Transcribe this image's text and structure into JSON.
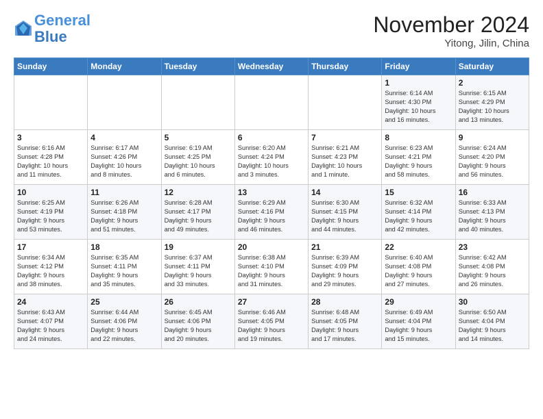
{
  "header": {
    "logo_line1": "General",
    "logo_line2": "Blue",
    "month": "November 2024",
    "location": "Yitong, Jilin, China"
  },
  "weekdays": [
    "Sunday",
    "Monday",
    "Tuesday",
    "Wednesday",
    "Thursday",
    "Friday",
    "Saturday"
  ],
  "weeks": [
    [
      {
        "day": "",
        "info": ""
      },
      {
        "day": "",
        "info": ""
      },
      {
        "day": "",
        "info": ""
      },
      {
        "day": "",
        "info": ""
      },
      {
        "day": "",
        "info": ""
      },
      {
        "day": "1",
        "info": "Sunrise: 6:14 AM\nSunset: 4:30 PM\nDaylight: 10 hours\nand 16 minutes."
      },
      {
        "day": "2",
        "info": "Sunrise: 6:15 AM\nSunset: 4:29 PM\nDaylight: 10 hours\nand 13 minutes."
      }
    ],
    [
      {
        "day": "3",
        "info": "Sunrise: 6:16 AM\nSunset: 4:28 PM\nDaylight: 10 hours\nand 11 minutes."
      },
      {
        "day": "4",
        "info": "Sunrise: 6:17 AM\nSunset: 4:26 PM\nDaylight: 10 hours\nand 8 minutes."
      },
      {
        "day": "5",
        "info": "Sunrise: 6:19 AM\nSunset: 4:25 PM\nDaylight: 10 hours\nand 6 minutes."
      },
      {
        "day": "6",
        "info": "Sunrise: 6:20 AM\nSunset: 4:24 PM\nDaylight: 10 hours\nand 3 minutes."
      },
      {
        "day": "7",
        "info": "Sunrise: 6:21 AM\nSunset: 4:23 PM\nDaylight: 10 hours\nand 1 minute."
      },
      {
        "day": "8",
        "info": "Sunrise: 6:23 AM\nSunset: 4:21 PM\nDaylight: 9 hours\nand 58 minutes."
      },
      {
        "day": "9",
        "info": "Sunrise: 6:24 AM\nSunset: 4:20 PM\nDaylight: 9 hours\nand 56 minutes."
      }
    ],
    [
      {
        "day": "10",
        "info": "Sunrise: 6:25 AM\nSunset: 4:19 PM\nDaylight: 9 hours\nand 53 minutes."
      },
      {
        "day": "11",
        "info": "Sunrise: 6:26 AM\nSunset: 4:18 PM\nDaylight: 9 hours\nand 51 minutes."
      },
      {
        "day": "12",
        "info": "Sunrise: 6:28 AM\nSunset: 4:17 PM\nDaylight: 9 hours\nand 49 minutes."
      },
      {
        "day": "13",
        "info": "Sunrise: 6:29 AM\nSunset: 4:16 PM\nDaylight: 9 hours\nand 46 minutes."
      },
      {
        "day": "14",
        "info": "Sunrise: 6:30 AM\nSunset: 4:15 PM\nDaylight: 9 hours\nand 44 minutes."
      },
      {
        "day": "15",
        "info": "Sunrise: 6:32 AM\nSunset: 4:14 PM\nDaylight: 9 hours\nand 42 minutes."
      },
      {
        "day": "16",
        "info": "Sunrise: 6:33 AM\nSunset: 4:13 PM\nDaylight: 9 hours\nand 40 minutes."
      }
    ],
    [
      {
        "day": "17",
        "info": "Sunrise: 6:34 AM\nSunset: 4:12 PM\nDaylight: 9 hours\nand 38 minutes."
      },
      {
        "day": "18",
        "info": "Sunrise: 6:35 AM\nSunset: 4:11 PM\nDaylight: 9 hours\nand 35 minutes."
      },
      {
        "day": "19",
        "info": "Sunrise: 6:37 AM\nSunset: 4:11 PM\nDaylight: 9 hours\nand 33 minutes."
      },
      {
        "day": "20",
        "info": "Sunrise: 6:38 AM\nSunset: 4:10 PM\nDaylight: 9 hours\nand 31 minutes."
      },
      {
        "day": "21",
        "info": "Sunrise: 6:39 AM\nSunset: 4:09 PM\nDaylight: 9 hours\nand 29 minutes."
      },
      {
        "day": "22",
        "info": "Sunrise: 6:40 AM\nSunset: 4:08 PM\nDaylight: 9 hours\nand 27 minutes."
      },
      {
        "day": "23",
        "info": "Sunrise: 6:42 AM\nSunset: 4:08 PM\nDaylight: 9 hours\nand 26 minutes."
      }
    ],
    [
      {
        "day": "24",
        "info": "Sunrise: 6:43 AM\nSunset: 4:07 PM\nDaylight: 9 hours\nand 24 minutes."
      },
      {
        "day": "25",
        "info": "Sunrise: 6:44 AM\nSunset: 4:06 PM\nDaylight: 9 hours\nand 22 minutes."
      },
      {
        "day": "26",
        "info": "Sunrise: 6:45 AM\nSunset: 4:06 PM\nDaylight: 9 hours\nand 20 minutes."
      },
      {
        "day": "27",
        "info": "Sunrise: 6:46 AM\nSunset: 4:05 PM\nDaylight: 9 hours\nand 19 minutes."
      },
      {
        "day": "28",
        "info": "Sunrise: 6:48 AM\nSunset: 4:05 PM\nDaylight: 9 hours\nand 17 minutes."
      },
      {
        "day": "29",
        "info": "Sunrise: 6:49 AM\nSunset: 4:04 PM\nDaylight: 9 hours\nand 15 minutes."
      },
      {
        "day": "30",
        "info": "Sunrise: 6:50 AM\nSunset: 4:04 PM\nDaylight: 9 hours\nand 14 minutes."
      }
    ]
  ]
}
